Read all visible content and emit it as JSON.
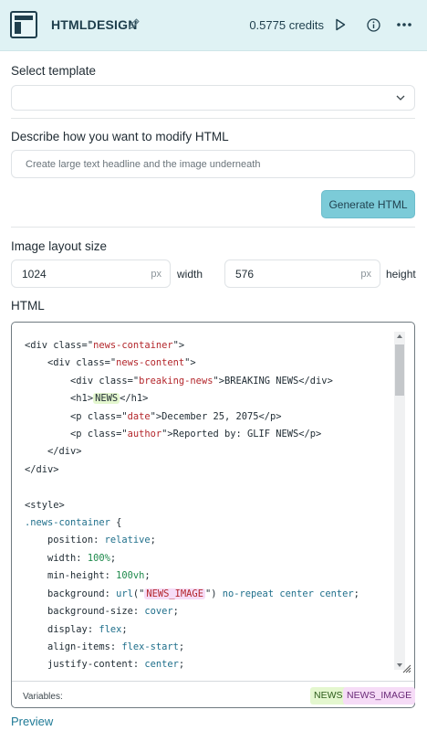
{
  "header": {
    "title": "HTMLDESIGN",
    "credits": "0.5775 credits"
  },
  "template": {
    "label": "Select template",
    "selected": ""
  },
  "modify": {
    "label": "Describe how you want to modify HTML",
    "placeholder": "Create large text headline and the image underneath",
    "button": "Generate HTML"
  },
  "layout": {
    "label": "Image layout size",
    "width_value": "1024",
    "width_unit": "px",
    "width_label": "width",
    "height_value": "576",
    "height_unit": "px",
    "height_label": "height"
  },
  "html_editor": {
    "label": "HTML",
    "lines": [
      "<div class=\"news-container\">",
      "    <div class=\"news-content\">",
      "        <div class=\"breaking-news\">BREAKING NEWS</div>",
      "        <h1>NEWS</h1>",
      "        <p class=\"date\">December 25, 2075</p>",
      "        <p class=\"author\">Reported by: GLIF NEWS</p>",
      "    </div>",
      "</div>",
      "",
      "<style>",
      ".news-container {",
      "    position: relative;",
      "    width: 100%;",
      "    min-height: 100vh;",
      "    background: url(\"NEWS_IMAGE\") no-repeat center center;",
      "    background-size: cover;",
      "    display: flex;",
      "    align-items: flex-start;",
      "    justify-content: center;"
    ],
    "variables_label": "Variables:",
    "variables": [
      "NEWS",
      "NEWS_IMAGE"
    ]
  },
  "footer": {
    "preview": "Preview"
  },
  "colors": {
    "header_bg": "#dff2f4",
    "accent_button": "#7ccbd8",
    "link": "#1f7a96",
    "var_news": "#e4f7cf",
    "var_image": "#f6dcf7"
  }
}
